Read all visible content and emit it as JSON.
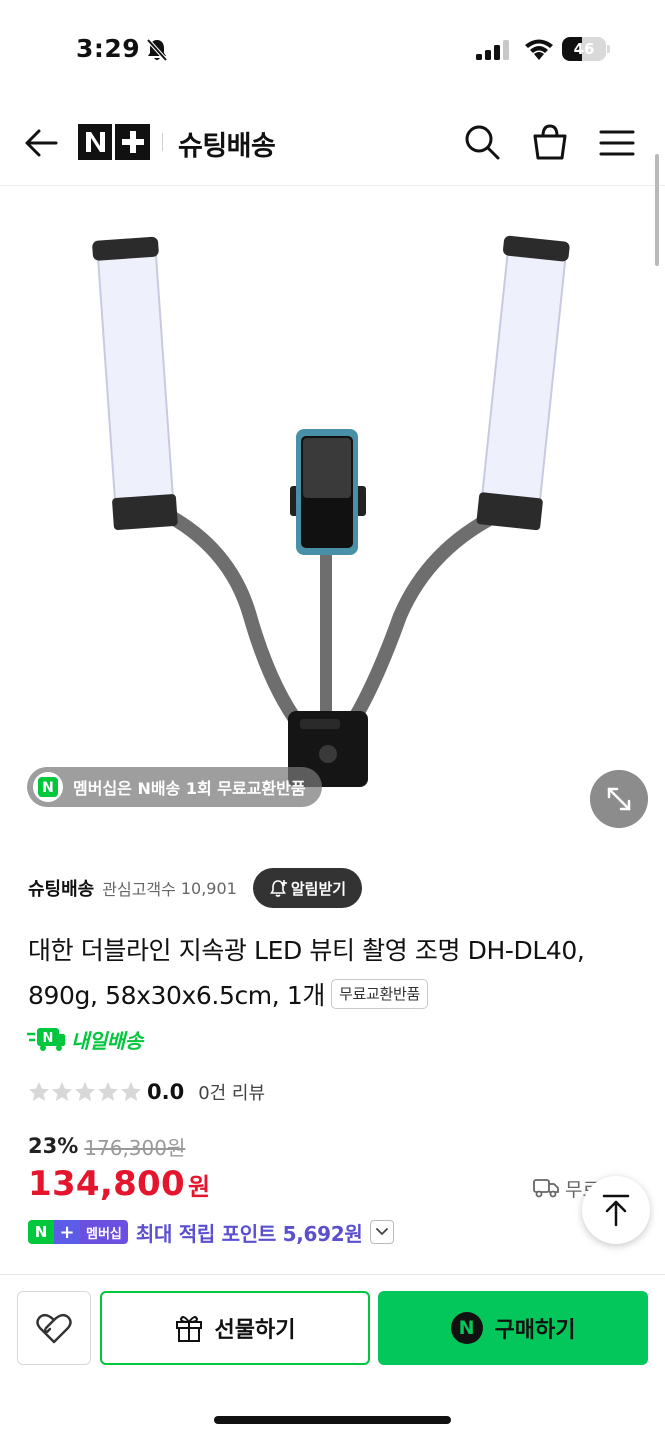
{
  "status_bar": {
    "time": "3:29",
    "battery_level": "46",
    "battery_percent": 46,
    "icons": [
      "bell-off-icon",
      "signal-icon",
      "wifi-icon",
      "battery-icon"
    ]
  },
  "header": {
    "logo_text": "N+",
    "store_name": "슈팅배송",
    "icons": [
      "back-arrow-icon",
      "search-icon",
      "cart-icon",
      "menu-icon"
    ]
  },
  "product_image": {
    "membership_banner": "멤버십은 N배송 1회 무료교환반품",
    "membership_icon_letter": "N"
  },
  "seller": {
    "name": "슈팅배송",
    "interest_label": "관심고객수",
    "interest_count": "10,901",
    "alarm_button": "알림받기"
  },
  "product": {
    "title": "대한 더블라인 지속광 LED 뷰티 촬영 조명 DH-DL40, 890g, 58x30x6.5cm, 1개",
    "title_badge": "무료교환반품",
    "delivery_label": "내일배송",
    "delivery_icon_letter": "N",
    "rating": {
      "value": "0.0",
      "review_count": "0건 리뷰",
      "stars_filled": 0,
      "stars_total": 5
    },
    "discount_rate": "23%",
    "original_price": "176,300원",
    "sale_price": "134,800",
    "sale_unit": "원",
    "shipping_text": "무료배송"
  },
  "membership_points": {
    "logo_n": "N",
    "logo_plus": "+",
    "logo_label": "멤버십",
    "text": "최대 적립 포인트 5,692원"
  },
  "bottom_bar": {
    "gift_label": "선물하기",
    "buy_label": "구매하기",
    "buy_icon_letter": "N"
  },
  "colors": {
    "brand_green": "#03c75a",
    "sale_red": "#e4152c",
    "points_purple": "#5b4fcf"
  }
}
